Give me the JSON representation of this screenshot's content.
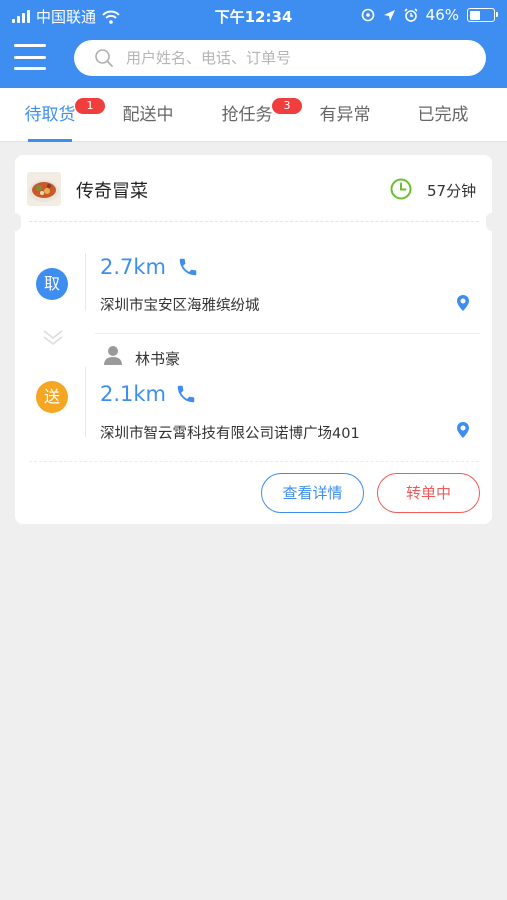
{
  "status_bar": {
    "carrier": "中国联通",
    "time": "下午12:34",
    "battery": "46%",
    "battery_level": 0.46
  },
  "header": {
    "search_placeholder": "用户姓名、电话、订单号"
  },
  "tabs": [
    {
      "label": "待取货",
      "badge": "1",
      "active": true
    },
    {
      "label": "配送中",
      "badge": "",
      "active": false
    },
    {
      "label": "抢任务",
      "badge": "3",
      "active": false
    },
    {
      "label": "有异常",
      "badge": "",
      "active": false
    },
    {
      "label": "已完成",
      "badge": "",
      "active": false
    }
  ],
  "order": {
    "shop_name": "传奇冒菜",
    "eta": "57分钟",
    "pickup": {
      "tag": "取",
      "distance": "2.7km",
      "address": "深圳市宝安区海雅缤纷城"
    },
    "delivery": {
      "tag": "送",
      "customer": "林书豪",
      "distance": "2.1km",
      "address": "深圳市智云霄科技有限公司诺博广场401"
    },
    "actions": {
      "detail": "查看详情",
      "transfer": "转单中"
    }
  },
  "colors": {
    "primary": "#3d8ef0",
    "pickup_circle": "#3d8ef0",
    "delivery_circle": "#f5a623",
    "badge": "#f03e3e",
    "clock": "#6abf2e",
    "transfer": "#f05a5a"
  }
}
